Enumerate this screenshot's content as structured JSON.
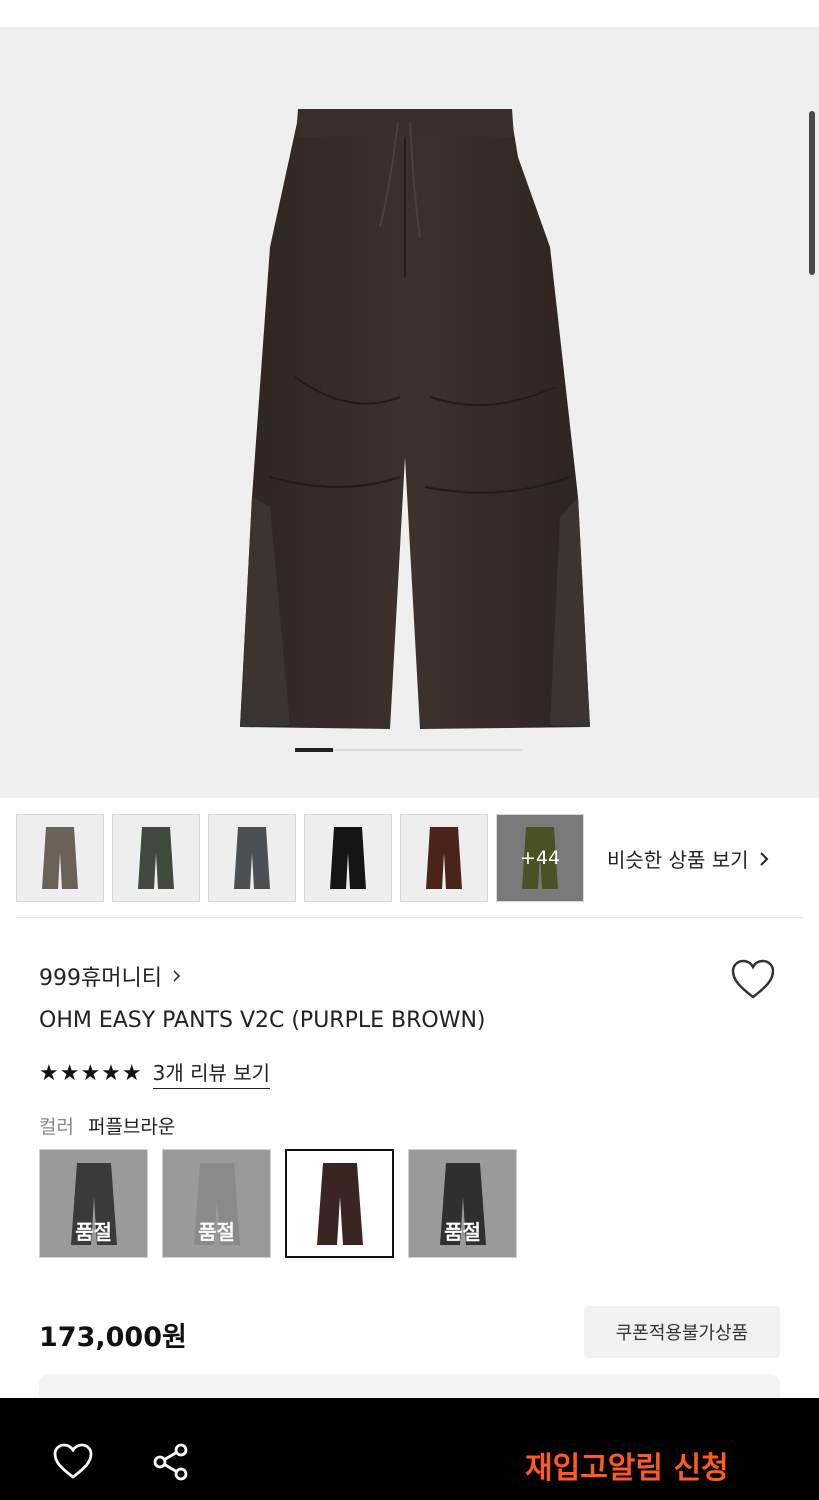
{
  "hero": {
    "image_alt": "wide pleated pants"
  },
  "thumbnails": {
    "items": [
      {
        "color": "#6b6257"
      },
      {
        "color": "#3f4a3d"
      },
      {
        "color": "#4a5053"
      },
      {
        "color": "#151515"
      },
      {
        "color": "#4a231a"
      },
      {
        "color": "#4b5226"
      }
    ],
    "more_label": "+44",
    "similar_label": "비슷한 상품 보기"
  },
  "product": {
    "brand": "999휴머니티",
    "title": "OHM EASY PANTS V2C (PURPLE BROWN)",
    "stars": "★★★★★",
    "review_link": "3개 리뷰 보기",
    "color_label": "컬러",
    "color_value": "퍼플브라운",
    "options": [
      {
        "soldout": "품절",
        "color": "#3a3a3a"
      },
      {
        "soldout": "품절",
        "color": "#8a8a8a"
      },
      {
        "soldout": "",
        "color": "#3a2621"
      },
      {
        "soldout": "품절",
        "color": "#2f2f2f"
      }
    ],
    "price": "173,000원",
    "coupon_label": "쿠폰적용불가상품"
  },
  "bottom_bar": {
    "restock_label": "재입고알림 신청",
    "accent": "#ff5a1f"
  }
}
